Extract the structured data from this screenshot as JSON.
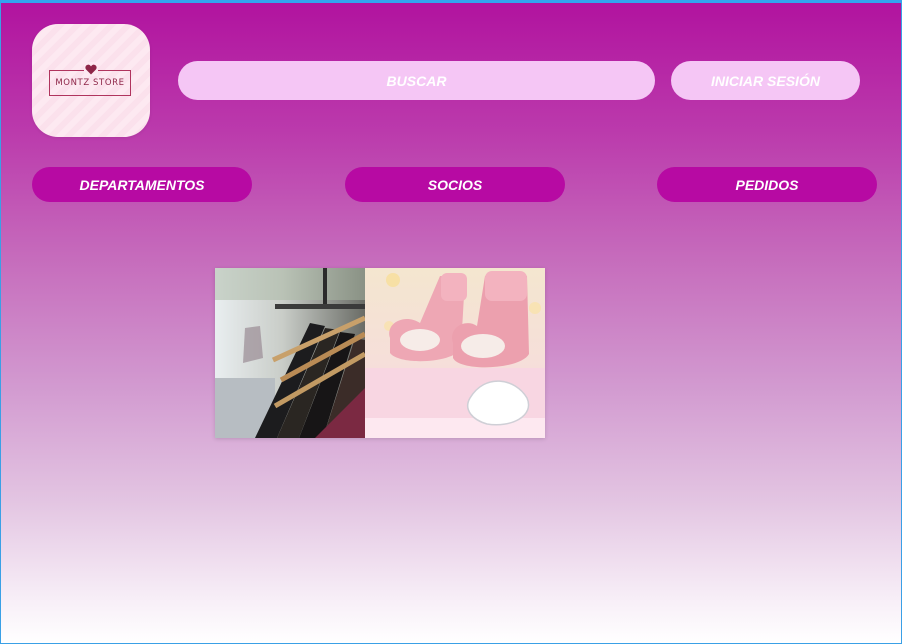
{
  "logo": {
    "text": "MONTZ STORE"
  },
  "header": {
    "search_placeholder": "BUSCAR",
    "login_label": "INICIAR SESIÓN"
  },
  "nav": {
    "items": [
      {
        "label": "DEPARTAMENTOS"
      },
      {
        "label": "SOCIOS"
      },
      {
        "label": "PEDIDOS"
      }
    ]
  },
  "colors": {
    "header_bg": "#b1139f",
    "pill_light": "#f5c6f5",
    "nav_pill": "#b70aa3",
    "logo_accent": "#8e2648"
  },
  "icons": {
    "logo_mark": "heart-icon"
  }
}
